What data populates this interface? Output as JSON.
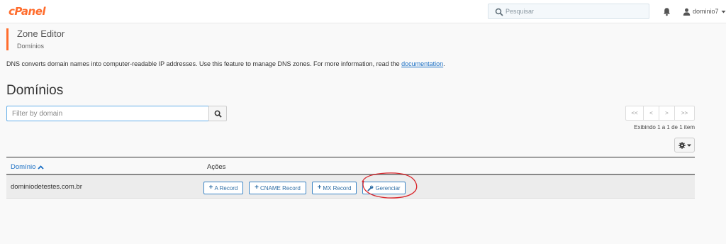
{
  "header": {
    "logo_text": "cPanel",
    "search_placeholder": "Pesquisar",
    "username": "dominio7",
    "accent_color": "#ff6c2c"
  },
  "page": {
    "title": "Zone Editor",
    "breadcrumb": "Domínios",
    "description": "DNS converts domain names into computer-readable IP addresses. Use this feature to manage DNS zones. For more information, read the ",
    "description_link": "documentation",
    "description_end": "."
  },
  "domains": {
    "title": "Domínios",
    "filter_placeholder": "Filter by domain",
    "pagination": {
      "first": "<<",
      "prev": "<",
      "next": ">",
      "last": ">>"
    },
    "showing": "Exibindo 1 a 1 de 1 item",
    "columns": {
      "domain": "Domínio",
      "actions": "Ações"
    },
    "rows": [
      {
        "domain": "dominiodetestes.com.br",
        "actions": {
          "a_record": "A Record",
          "cname_record": "CNAME Record",
          "mx_record": "MX Record",
          "manage": "Gerenciar"
        }
      }
    ]
  },
  "icons": {
    "search": "search-icon",
    "bell": "bell-icon",
    "user": "user-icon",
    "caret": "caret-down-icon",
    "sort": "sort-asc-icon",
    "gear": "gear-icon",
    "plus": "plus-icon",
    "wrench": "wrench-icon"
  },
  "annotation_color": "#d9262c"
}
